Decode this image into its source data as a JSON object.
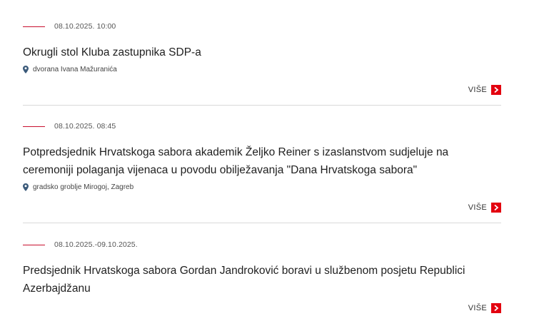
{
  "events": [
    {
      "date": "08.10.2025. 10:00",
      "title": "Okrugli stol Kluba zastupnika SDP-a",
      "location": "dvorana Ivana Mažuranića",
      "more_label": "VIŠE"
    },
    {
      "date": "08.10.2025. 08:45",
      "title": "Potpredsjednik Hrvatskoga sabora akademik Željko Reiner s izaslanstvom sudjeluje na ceremoniji polaganja vijenaca u povodu obilježavanja \"Dana Hrvatskoga sabora\"",
      "location": "gradsko groblje Mirogoj, Zagreb",
      "more_label": "VIŠE"
    },
    {
      "date": "08.10.2025.-09.10.2025.",
      "title": "Predsjednik Hrvatskoga sabora Gordan Jandroković boravi u službenom posjetu Republici Azerbajdžanu",
      "more_label": "VIŠE"
    }
  ],
  "colors": {
    "accent": "#e3000f",
    "dash": "#c8102e",
    "separator": "#d9d9d9",
    "pin": "#3b5a7a"
  },
  "icons": {
    "location": "map-pin-icon",
    "more": "chevron-right-icon"
  }
}
